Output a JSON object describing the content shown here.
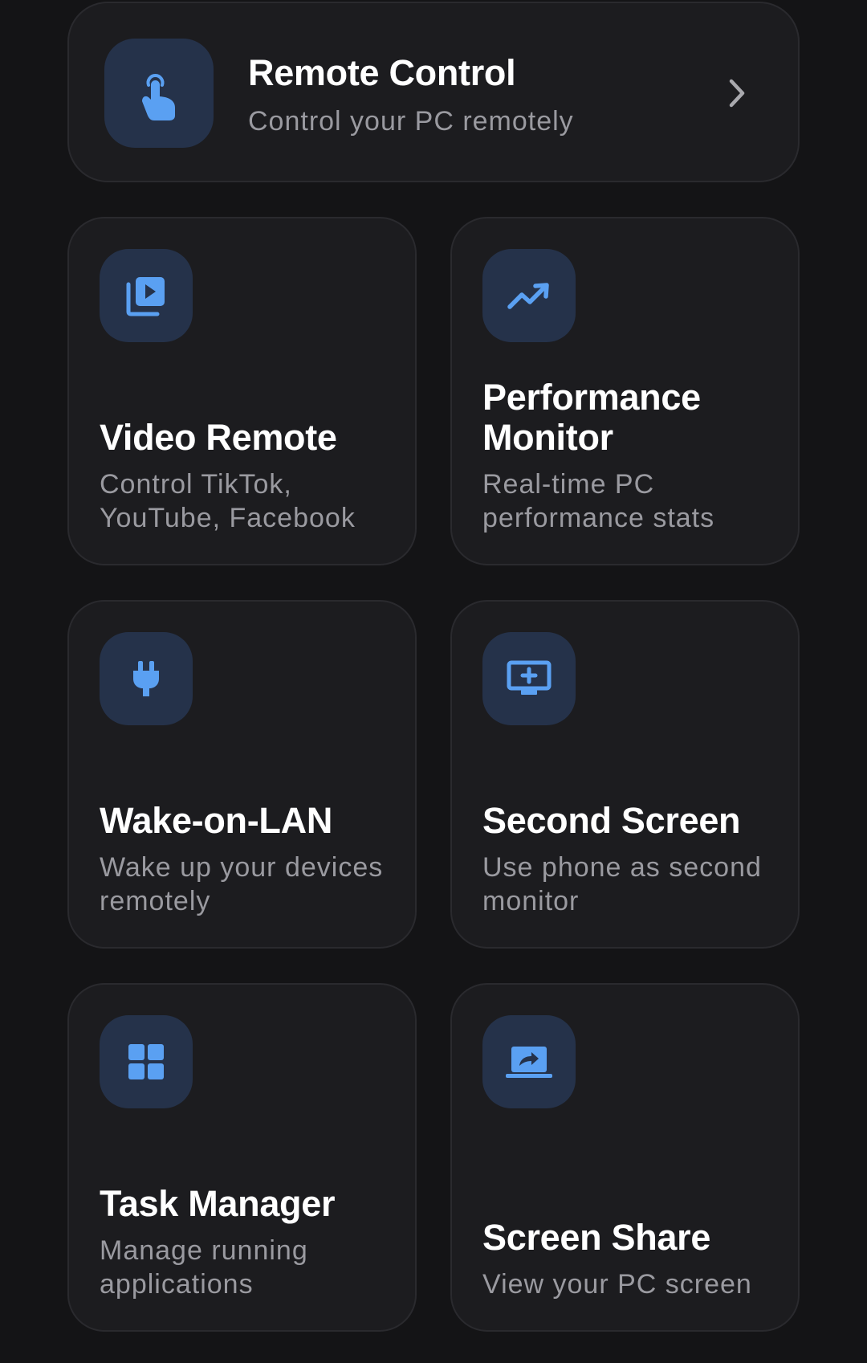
{
  "accent_color": "#5aa0f2",
  "icon_bg_color": "#25324a",
  "remote_control": {
    "title": "Remote Control",
    "subtitle": "Control your PC remotely",
    "icon": "touch-pointer-icon",
    "chevron_icon": "chevron-right-icon"
  },
  "features": [
    {
      "title": "Video Remote",
      "subtitle": "Control TikTok, YouTube, Facebook",
      "icon": "video-library-icon"
    },
    {
      "title": "Performance Monitor",
      "subtitle": "Real-time PC performance stats",
      "icon": "trending-up-icon"
    },
    {
      "title": "Wake-on-LAN",
      "subtitle": "Wake up your devices remotely",
      "icon": "power-plug-icon"
    },
    {
      "title": "Second Screen",
      "subtitle": "Use phone as second monitor",
      "icon": "monitor-add-icon"
    },
    {
      "title": "Task Manager",
      "subtitle": "Manage running applications",
      "icon": "grid-squares-icon"
    },
    {
      "title": "Screen Share",
      "subtitle": "View your PC screen",
      "icon": "laptop-share-icon"
    }
  ]
}
